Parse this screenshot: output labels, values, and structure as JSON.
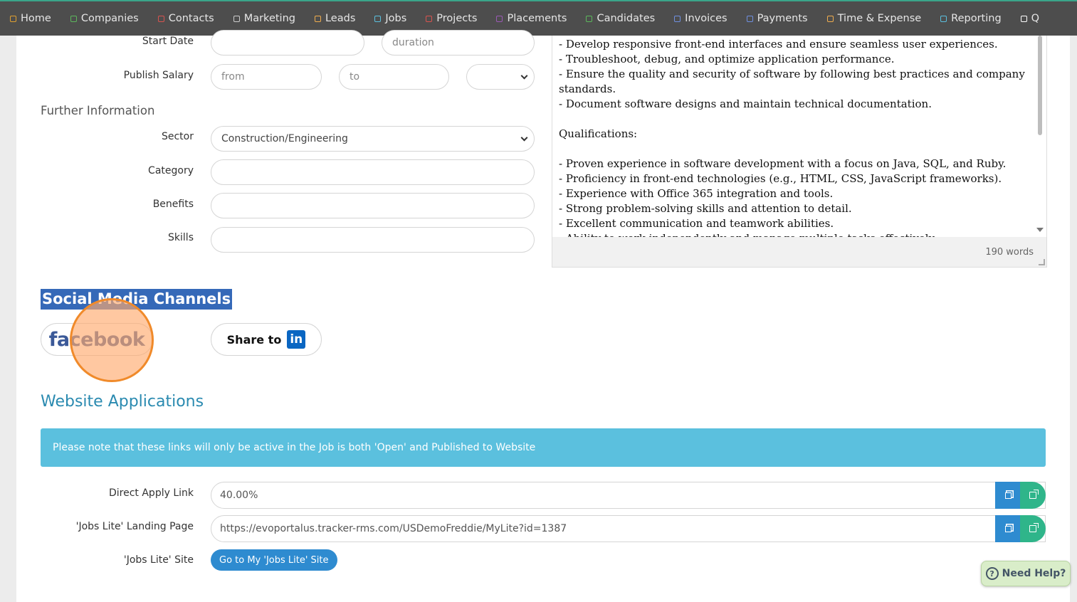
{
  "nav": {
    "items": [
      {
        "label": "Home",
        "color": "#e0a030"
      },
      {
        "label": "Companies",
        "color": "#5cb85c"
      },
      {
        "label": "Contacts",
        "color": "#d9534f"
      },
      {
        "label": "Marketing",
        "color": "#cccccc"
      },
      {
        "label": "Leads",
        "color": "#f0ad4e"
      },
      {
        "label": "Jobs",
        "color": "#5bc0de"
      },
      {
        "label": "Projects",
        "color": "#d9534f"
      },
      {
        "label": "Placements",
        "color": "#9b59b6"
      },
      {
        "label": "Candidates",
        "color": "#5cb85c"
      },
      {
        "label": "Invoices",
        "color": "#6f8fe0"
      },
      {
        "label": "Payments",
        "color": "#6f8fe0"
      },
      {
        "label": "Time & Expense",
        "color": "#f0ad4e"
      },
      {
        "label": "Reporting",
        "color": "#5bc0de"
      },
      {
        "label": "Q",
        "color": "#ffffff"
      }
    ]
  },
  "form": {
    "start_date_label": "Start Date",
    "start_date_value": "",
    "duration_placeholder": "duration",
    "publish_salary_label": "Publish Salary",
    "salary_from_placeholder": "from",
    "salary_to_placeholder": "to",
    "salary_period_value": "",
    "further_info_title": "Further Information",
    "sector_label": "Sector",
    "sector_value": "Construction/Engineering",
    "category_label": "Category",
    "category_value": "",
    "benefits_label": "Benefits",
    "benefits_value": "",
    "skills_label": "Skills",
    "skills_value": ""
  },
  "editor": {
    "lines": [
      "- Develop responsive front-end interfaces and ensure seamless user experiences.",
      "- Troubleshoot, debug, and optimize application performance.",
      "- Ensure the quality and security of software by following best practices and company standards.",
      "- Document software designs and maintain technical documentation.",
      "",
      "Qualifications:",
      "",
      "- Proven experience in software development with a focus on Java, SQL, and Ruby.",
      "- Proficiency in front-end technologies (e.g., HTML, CSS, JavaScript frameworks).",
      "- Experience with Office 365 integration and tools.",
      "- Strong problem-solving skills and attention to detail.",
      "- Excellent communication and teamwork abilities.",
      "- Ability to work independently and manage multiple tasks effectively."
    ],
    "word_count": "190 words"
  },
  "social": {
    "title": "Social Media Channels",
    "facebook_label": "facebook",
    "linkedin_label": "Share to",
    "linkedin_logo": "in"
  },
  "website": {
    "title": "Website Applications",
    "notice": "Please note that these links will only be active in the Job is both 'Open' and Published to Website",
    "direct_apply_label": "Direct Apply Link",
    "direct_apply_value": "40.00%",
    "landing_page_label": "'Jobs Lite' Landing Page",
    "landing_page_value": "https://evoportalus.tracker-rms.com/USDemoFreddie/MyLite?id=1387",
    "lite_site_label": "'Jobs Lite' Site",
    "lite_site_button": "Go to My 'Jobs Lite' Site"
  },
  "help": {
    "label": "Need Help?",
    "icon_glyph": "?"
  }
}
